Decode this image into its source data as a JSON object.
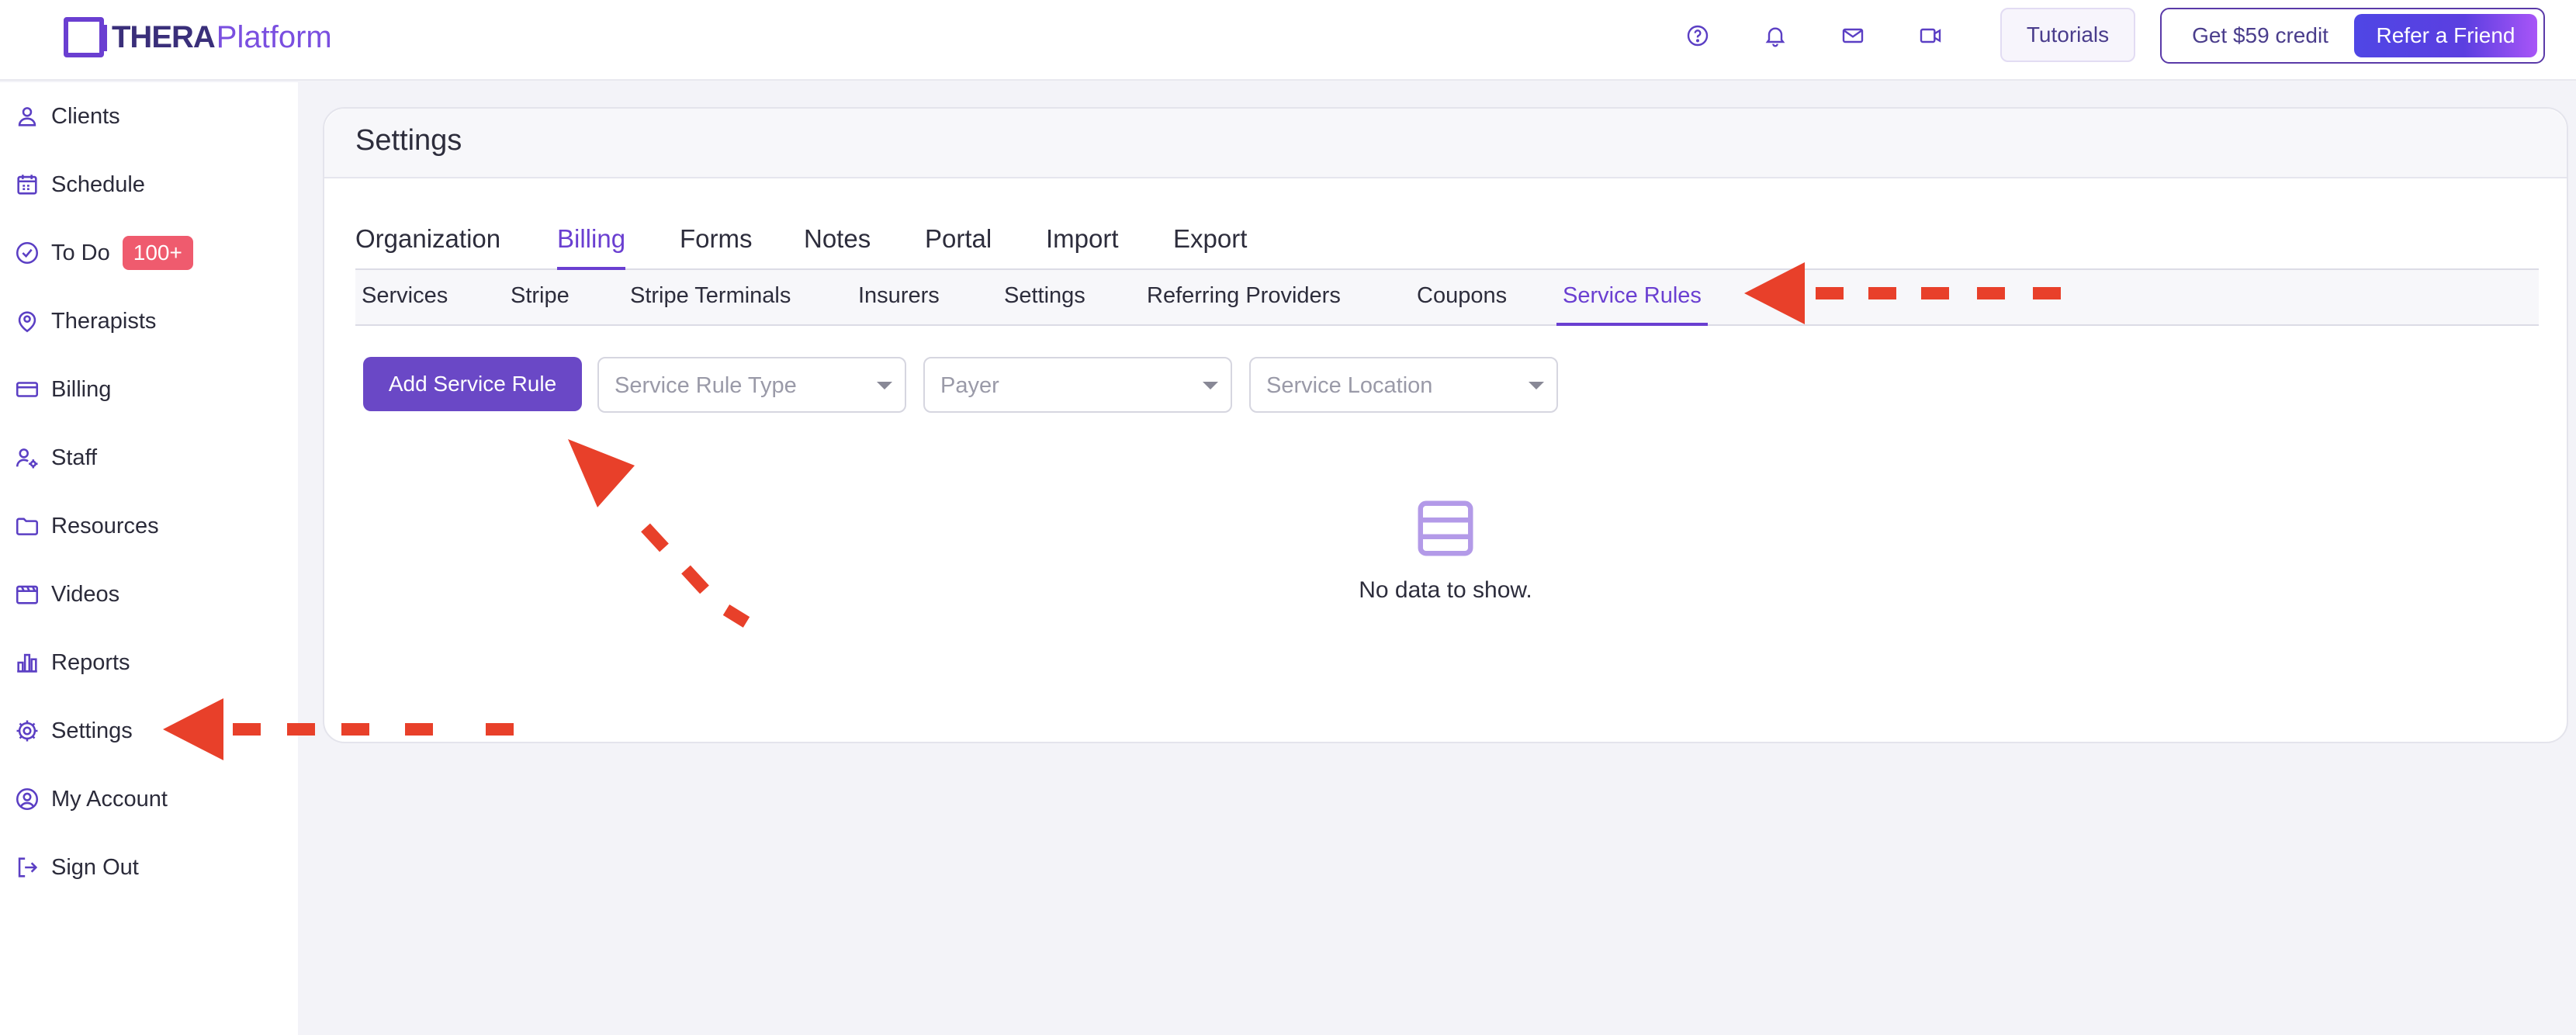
{
  "brand": {
    "name_bold": "THERA",
    "name_light": "Platform"
  },
  "topbar": {
    "icons": [
      "help-icon",
      "bell-icon",
      "mail-icon",
      "video-icon"
    ],
    "tutorials_label": "Tutorials",
    "credit_label": "Get $59 credit",
    "refer_label": "Refer a Friend"
  },
  "sidebar": {
    "items": [
      {
        "label": "Clients",
        "icon": "person-icon"
      },
      {
        "label": "Schedule",
        "icon": "calendar-icon"
      },
      {
        "label": "To Do",
        "icon": "check-circle-icon",
        "badge": "100+"
      },
      {
        "label": "Therapists",
        "icon": "therapist-icon"
      },
      {
        "label": "Billing",
        "icon": "credit-card-icon"
      },
      {
        "label": "Staff",
        "icon": "staff-icon"
      },
      {
        "label": "Resources",
        "icon": "folder-icon"
      },
      {
        "label": "Videos",
        "icon": "film-icon"
      },
      {
        "label": "Reports",
        "icon": "bar-chart-icon"
      },
      {
        "label": "Settings",
        "icon": "gear-icon"
      },
      {
        "label": "My Account",
        "icon": "account-circle-icon"
      },
      {
        "label": "Sign Out",
        "icon": "sign-out-icon"
      }
    ]
  },
  "main": {
    "title": "Settings",
    "tabs": [
      "Organization",
      "Billing",
      "Forms",
      "Notes",
      "Portal",
      "Import",
      "Export"
    ],
    "active_tab": "Billing",
    "subtabs": [
      "Services",
      "Stripe",
      "Stripe Terminals",
      "Insurers",
      "Settings",
      "Referring Providers",
      "Coupons",
      "Service Rules"
    ],
    "active_subtab": "Service Rules",
    "add_button_label": "Add Service Rule",
    "filters": {
      "service_rule_type_placeholder": "Service Rule Type",
      "payer_placeholder": "Payer",
      "service_location_placeholder": "Service Location"
    },
    "empty_text": "No data to show."
  },
  "colors": {
    "accent": "#6a3fd1",
    "badge": "#ef5b6e",
    "annotation_arrow": "#e8402a"
  }
}
